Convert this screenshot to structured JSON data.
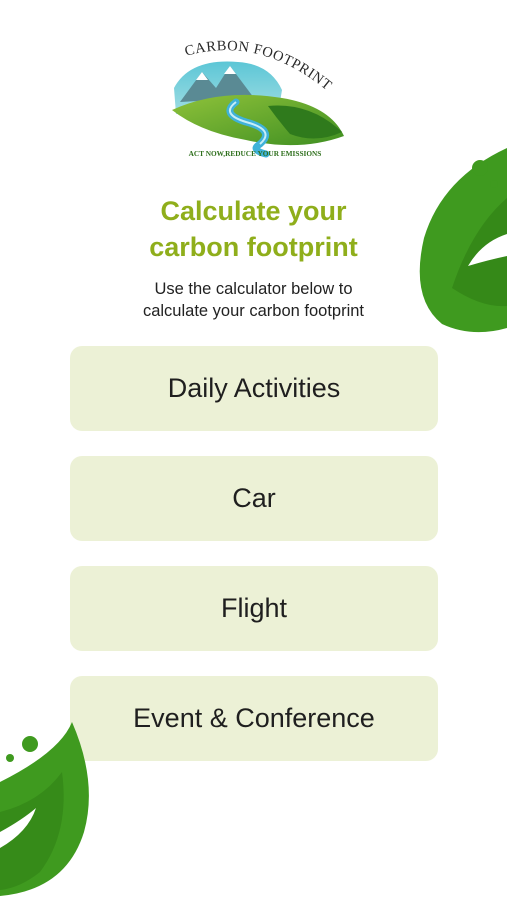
{
  "logo": {
    "title": "CARBON FOOTPRINT",
    "tagline": "ACT NOW,REDUCE YOUR EMISSIONS"
  },
  "header": {
    "title_line1": "Calculate your",
    "title_line2": "carbon footprint",
    "subtitle_line1": "Use the calculator below to",
    "subtitle_line2": "calculate your carbon footprint"
  },
  "menu": {
    "items": [
      {
        "label": "Daily Activities"
      },
      {
        "label": "Car"
      },
      {
        "label": "Flight"
      },
      {
        "label": "Event & Conference"
      }
    ]
  },
  "colors": {
    "accent": "#8fae1b",
    "button_bg": "#ecf1d6",
    "leaf_green": "#3f9a1f"
  }
}
